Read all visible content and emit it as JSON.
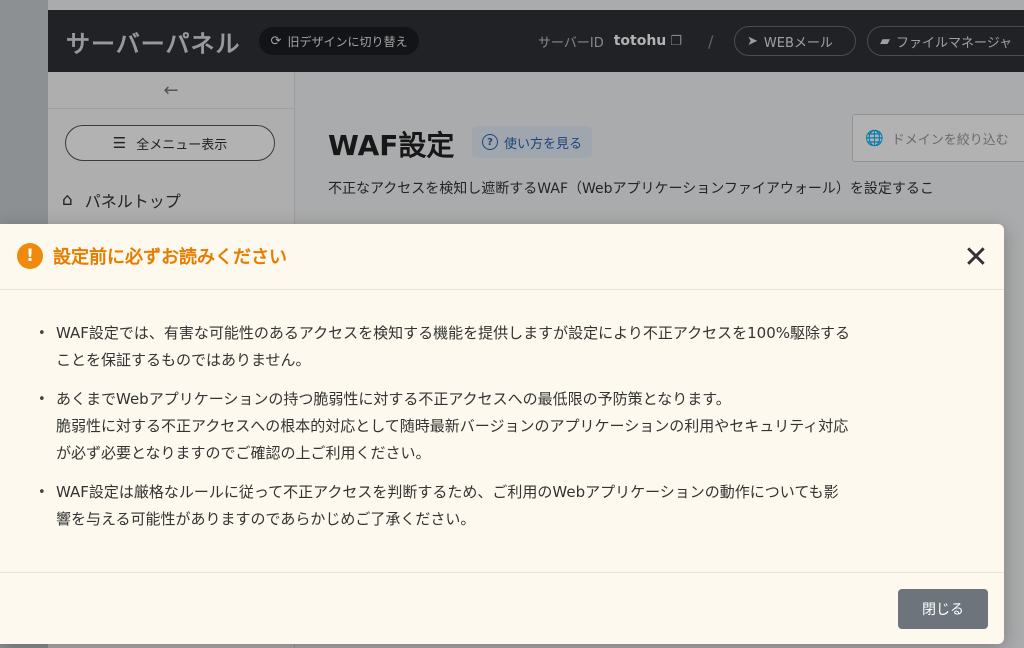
{
  "header": {
    "brand": "サーバーパネル",
    "old_design_label": "旧デザインに切り替え",
    "server_id_label": "サーバーID",
    "server_id_value": "totohu",
    "separator": "/",
    "webmail_label": "WEBメール",
    "file_manager_label": "ファイルマネージャ"
  },
  "sidebar": {
    "back_icon": "←",
    "all_menu_label": "全メニュー表示",
    "items": [
      {
        "label": "パネルトップ"
      }
    ]
  },
  "main": {
    "title": "WAF設定",
    "howto_label": "使い方を見る",
    "domain_filter_placeholder": "ドメインを絞り込む",
    "description": "不正なアクセスを検知し遮断するWAF（Webアプリケーションファイアウォール）を設定するこ"
  },
  "modal": {
    "title": "設定前に必ずお読みください",
    "warn_icon": "!",
    "close_icon": "✕",
    "items": [
      {
        "lines": [
          "WAF設定では、有害な可能性のあるアクセスを検知する機能を提供しますが設定により不正アクセスを100%駆除する",
          "ことを保証するものではありません。"
        ]
      },
      {
        "lines": [
          "あくまでWebアプリケーションの持つ脆弱性に対する不正アクセスへの最低限の予防策となります。",
          "脆弱性に対する不正アクセスへの根本的対応として随時最新バージョンのアプリケーションの利用やセキュリティ対応",
          "が必ず必要となりますのでご確認の上ご利用ください。"
        ]
      },
      {
        "lines": [
          "WAF設定は厳格なルールに従って不正アクセスを判断するため、ご利用のWebアプリケーションの動作についても影",
          "響を与える可能性がありますのであらかじめご了承ください。"
        ]
      }
    ],
    "close_button_label": "閉じる"
  },
  "colors": {
    "accent_orange": "#f08a0c",
    "modal_bg": "#fdf9ef",
    "close_button_bg": "#6d747b",
    "header_bg": "#2f3236"
  }
}
